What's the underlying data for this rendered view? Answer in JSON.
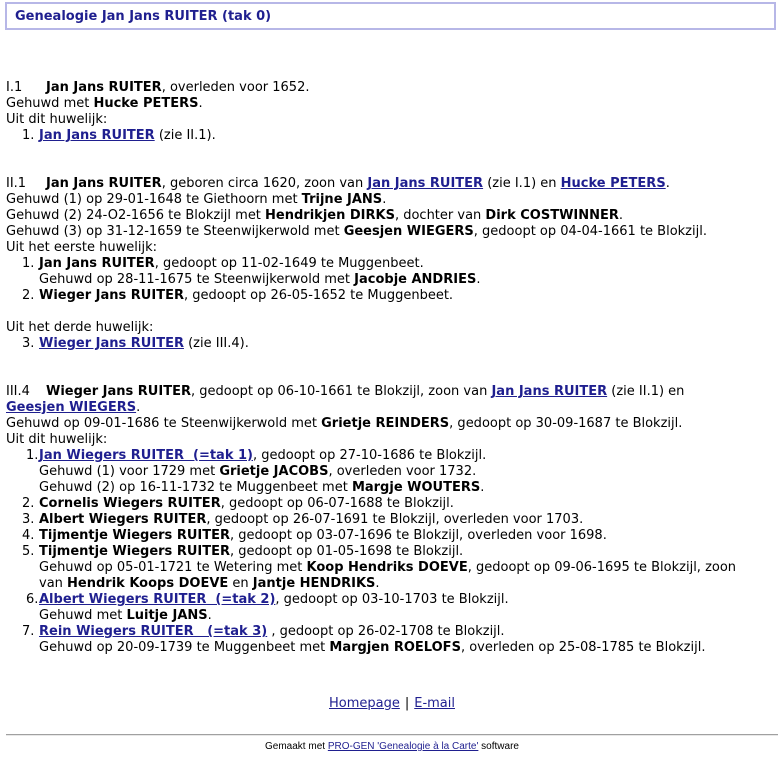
{
  "title": "Genealogie Jan Jans RUITER (tak 0)",
  "s1": {
    "index": "I.1",
    "name": "Jan Jans RUITER",
    "t1": ", overleden voor 1652.",
    "m_pre": "Gehuwd met ",
    "m_name": "Hucke PETERS",
    "m_post": ".",
    "kids_label": "Uit dit huwelijk:",
    "c1_num": "1.",
    "c1_link": "Jan Jans RUITER",
    "c1_post": " (zie II.1)."
  },
  "s2": {
    "index": "II.1",
    "name": "Jan Jans RUITER",
    "t1": ", geboren circa 1620, zoon van ",
    "link_father": "Jan Jans RUITER",
    "t2": " (zie I.1) en ",
    "link_mother": "Hucke PETERS",
    "t3": ".",
    "m1_pre": "Gehuwd (1) op 29-01-1648 te Giethoorn met ",
    "m1_name": "Trijne JANS",
    "m1_post": ".",
    "m2_pre": "Gehuwd (2) 24-O2-1656 te Blokzijl met ",
    "m2_name": "Hendrikjen DIRKS",
    "m2_mid": ", dochter van ",
    "m2_name2": "Dirk COSTWINNER",
    "m2_post": ".",
    "m3_pre": "Gehuwd (3) op 31-12-1659 te Steenwijkerwold met ",
    "m3_name": "Geesjen WIEGERS",
    "m3_post": ", gedoopt op 04-04-1661 te Blokzijl.",
    "kids1_label": "Uit het eerste huwelijk:",
    "c1_num": "1.",
    "c1_name": "Jan Jans RUITER",
    "c1_post": ", gedoopt op 11-02-1649 te Muggenbeet.",
    "c1_m_pre": "Gehuwd op 28-11-1675 te Steenwijkerwold met ",
    "c1_m_name": "Jacobje ANDRIES",
    "c1_m_post": ".",
    "c2_num": "2.",
    "c2_name": "Wieger Jans RUITER",
    "c2_post": ", gedoopt op 26-05-1652 te Muggenbeet.",
    "kids3_label": "Uit het derde huwelijk:",
    "c3_num": "3.",
    "c3_link": "Wieger Jans RUITER",
    "c3_post": " (zie III.4)."
  },
  "s3": {
    "index": "III.4",
    "name": "Wieger Jans RUITER",
    "t1": ", gedoopt op 06-10-1661 te Blokzijl, zoon van ",
    "link_father": "Jan Jans RUITER",
    "t2": " (zie II.1) en ",
    "link_mother": "Geesjen WIEGERS",
    "t3": ".",
    "m_pre": "Gehuwd op 09-01-1686 te Steenwijkerwold met ",
    "m_name": "Grietje REINDERS",
    "m_post": ", gedoopt op 30-09-1687 te Blokzijl.",
    "kids_label": "Uit dit huwelijk:",
    "c1_num": "1.",
    "c1_link": "Jan Wiegers RUITER  (=tak 1)",
    "c1_post": ", gedoopt op 27-10-1686 te Blokzijl.",
    "c1_m1_pre": "Gehuwd (1) voor 1729 met ",
    "c1_m1_name": "Grietje JACOBS",
    "c1_m1_post": ", overleden voor 1732.",
    "c1_m2_pre": "Gehuwd (2) op 16-11-1732 te Muggenbeet met ",
    "c1_m2_name": "Margje WOUTERS",
    "c1_m2_post": ".",
    "c2_num": "2.",
    "c2_name": "Cornelis Wiegers RUITER",
    "c2_post": ", gedoopt op 06-07-1688 te Blokzijl.",
    "c3_num": "3.",
    "c3_name": "Albert Wiegers RUITER",
    "c3_post": ", gedoopt op 26-07-1691 te Blokzijl, overleden voor 1703.",
    "c4_num": "4.",
    "c4_name": "Tijmentje Wiegers RUITER",
    "c4_post": ", gedoopt op 03-07-1696 te Blokzijl, overleden voor 1698.",
    "c5_num": "5.",
    "c5_name": "Tijmentje Wiegers RUITER",
    "c5_post": ", gedoopt op 01-05-1698 te Blokzijl.",
    "c5_m_pre": "Gehuwd op 05-01-1721 te Wetering met ",
    "c5_m_name": "Koop Hendriks DOEVE",
    "c5_m_mid": ", gedoopt op 09-06-1695 te Blokzijl, zoon",
    "c5_m_l2_pre": "van ",
    "c5_m_name2": "Hendrik Koops DOEVE",
    "c5_m_and": " en ",
    "c5_m_name3": "Jantje HENDRIKS",
    "c5_m_post": ".",
    "c6_num": "6.",
    "c6_link": "Albert Wiegers RUITER  (=tak 2)",
    "c6_post": ", gedoopt op 03-10-1703 te Blokzijl.",
    "c6_m_pre": "Gehuwd met ",
    "c6_m_name": "Luitje JANS",
    "c6_m_post": ".",
    "c7_num": "7.",
    "c7_link": "Rein Wiegers RUITER   (=tak 3)",
    "c7_post": " , gedoopt op 26-02-1708 te Blokzijl.",
    "c7_m_pre": "Gehuwd op 20-09-1739 te Muggenbeet met ",
    "c7_m_name": "Margjen ROELOFS",
    "c7_m_post": ", overleden op 25-08-1785 te Blokzijl."
  },
  "nav": {
    "home": "Homepage",
    "sep": "|",
    "email": "E-mail"
  },
  "footer": {
    "pre": "Gemaakt met ",
    "link": "PRO-GEN 'Genealogie à la Carte'",
    "post": " software"
  }
}
